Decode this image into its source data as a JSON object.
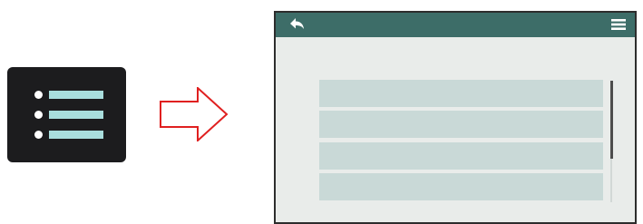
{
  "colors": {
    "list_tile_background": "#1c1c1e",
    "list_tile_line": "#a9dedd",
    "list_tile_bullet": "#ffffff",
    "arrow_outline": "#e02020",
    "titlebar": "#3d6d68",
    "screen_background": "#e9ecea",
    "list_row": "#c9d9d7",
    "scroll_thumb": "#4d4d4d"
  },
  "list_tile": {
    "icon": "list-icon",
    "lines": 3
  },
  "arrow": {
    "icon": "right-arrow-outline-icon",
    "direction": "right"
  },
  "screen": {
    "titlebar": {
      "left_icon": "back-arrow-icon",
      "right_icon": "hamburger-menu-icon"
    },
    "list": {
      "rows": 4,
      "scroll_fraction_visible": 0.64
    }
  }
}
